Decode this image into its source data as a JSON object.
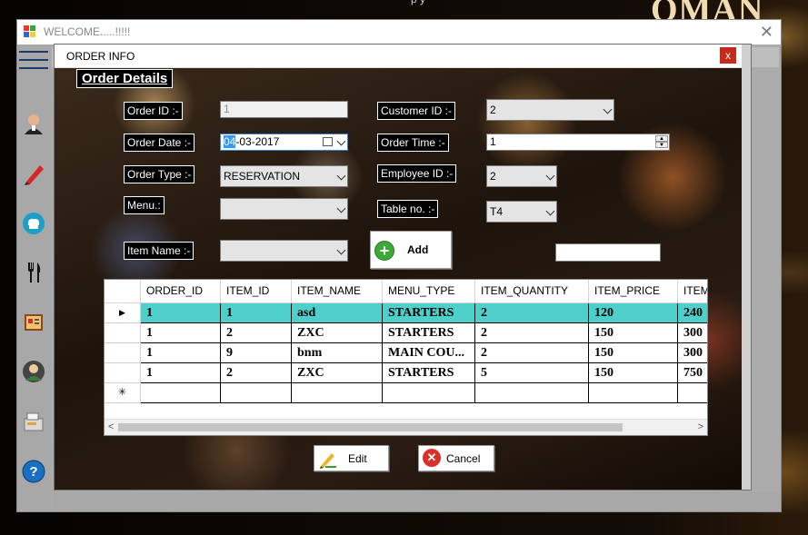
{
  "desktop": {
    "brand_text": "OMAN",
    "top_text": "p y"
  },
  "main_window": {
    "title": "WELCOME.....!!!!!",
    "close_glyph": "✕"
  },
  "sidebar": {
    "icons": [
      "customer-icon",
      "pen-icon",
      "chef-icon",
      "fork-knife-icon",
      "menu-book-icon",
      "employee-icon",
      "register-icon",
      "help-icon"
    ]
  },
  "order_window": {
    "title": "ORDER INFO",
    "close_glyph": "x",
    "heading": "Order Details",
    "order_id": {
      "label": "Order ID :-",
      "value": "1"
    },
    "order_date": {
      "label": "Order Date :-",
      "value_highlight": "04",
      "value_rest": "-03-2017"
    },
    "order_type": {
      "label": "Order Type :-",
      "value": "RESERVATION"
    },
    "menu": {
      "label": "Menu.:",
      "value": ""
    },
    "item_name": {
      "label": "Item Name :-",
      "value": ""
    },
    "customer_id": {
      "label": "Customer ID :-",
      "value": "2"
    },
    "order_time": {
      "label": "Order Time :-",
      "value": "1"
    },
    "employee_id": {
      "label": "Employee ID :-",
      "value": "2"
    },
    "table_no": {
      "label": "Table no. :-",
      "value": "T4"
    },
    "extra_input": {
      "value": ""
    },
    "add_button": {
      "label": "Add"
    },
    "edit_button": {
      "label": "Edit"
    },
    "cancel_button": {
      "label": "Cancel"
    }
  },
  "grid": {
    "columns": [
      "ORDER_ID",
      "ITEM_ID",
      "ITEM_NAME",
      "MENU_TYPE",
      "ITEM_QUANTITY",
      "ITEM_PRICE",
      "ITEM"
    ],
    "rows": [
      [
        "1",
        "1",
        "asd",
        "STARTERS",
        "2",
        "120",
        "240"
      ],
      [
        "1",
        "2",
        "ZXC",
        "STARTERS",
        "2",
        "150",
        "300"
      ],
      [
        "1",
        "9",
        "bnm",
        "MAIN COU...",
        "2",
        "150",
        "300"
      ],
      [
        "1",
        "2",
        "ZXC",
        "STARTERS",
        "5",
        "150",
        "750"
      ]
    ],
    "selected_row": 0,
    "current_row_marker": "▶",
    "new_row_marker": "✳"
  },
  "colors": {
    "selected_row": "#4fcfca",
    "close_red": "#c42b1c",
    "add_green": "#3aa935",
    "cancel_red": "#d9302a"
  }
}
